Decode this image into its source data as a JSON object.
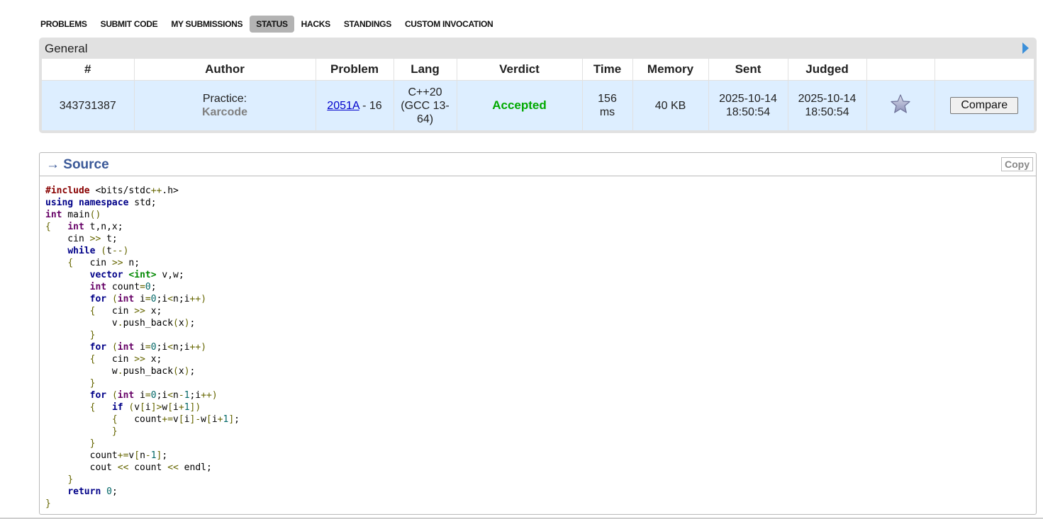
{
  "nav": {
    "items": [
      {
        "label": "PROBLEMS",
        "active": false
      },
      {
        "label": "SUBMIT CODE",
        "active": false
      },
      {
        "label": "MY SUBMISSIONS",
        "active": false
      },
      {
        "label": "STATUS",
        "active": true
      },
      {
        "label": "HACKS",
        "active": false
      },
      {
        "label": "STANDINGS",
        "active": false
      },
      {
        "label": "CUSTOM INVOCATION",
        "active": false
      }
    ]
  },
  "general": {
    "title": "General",
    "columns": [
      "#",
      "Author",
      "Problem",
      "Lang",
      "Verdict",
      "Time",
      "Memory",
      "Sent",
      "Judged",
      "",
      ""
    ],
    "row": {
      "id": "343731387",
      "author_label": "Practice:",
      "author_name": "Karcode",
      "problem_link": "2051A",
      "problem_suffix": " - 16",
      "lang_lines": [
        "C++20",
        "(GCC 13-",
        "64)"
      ],
      "verdict": "Accepted",
      "time_lines": [
        "156",
        "ms"
      ],
      "memory": "40 KB",
      "sent_lines": [
        "2025-10-14",
        "18:50:54"
      ],
      "judged_lines": [
        "2025-10-14",
        "18:50:54"
      ],
      "compare_label": "Compare"
    },
    "colors": {
      "verdict": "#00a900",
      "row_bg": "#ddeeff",
      "panel_bg": "#e1e1e1"
    }
  },
  "source": {
    "title": "→ Source",
    "copy_label": "Copy",
    "code": [
      "#include <bits/stdc++.h>",
      "using namespace std;",
      "int main()",
      "{   int t,n,x;",
      "    cin >> t;",
      "    while (t--)",
      "    {   cin >> n;",
      "        vector <int> v,w;",
      "        int count=0;",
      "        for (int i=0;i<n;i++)",
      "        {   cin >> x;",
      "            v.push_back(x);",
      "        }",
      "        for (int i=0;i<n;i++)",
      "        {   cin >> x;",
      "            w.push_back(x);",
      "        }",
      "        for (int i=0;i<n-1;i++)",
      "        {   if (v[i]>w[i+1])",
      "            {   count+=v[i]-w[i+1];",
      "            }",
      "        }",
      "        count+=v[n-1];",
      "        cout << count << endl;",
      "    }",
      "    return 0;",
      "}"
    ]
  }
}
